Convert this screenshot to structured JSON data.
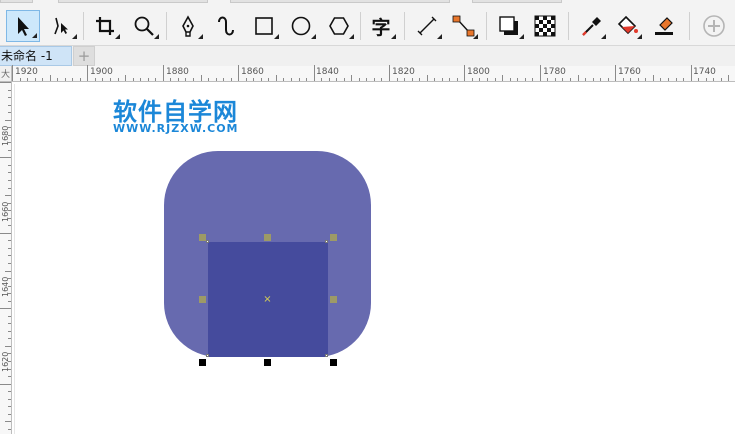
{
  "toolbar": {
    "tools": [
      {
        "name": "pick-tool",
        "icon": "arrow-pointer-icon",
        "active": true
      },
      {
        "name": "shape-tool",
        "icon": "node-edit-icon"
      },
      {
        "name": "crop-tool",
        "icon": "crop-icon"
      },
      {
        "name": "zoom-tool",
        "icon": "magnifier-icon"
      },
      {
        "name": "freehand-tool",
        "icon": "pen-nib-icon"
      },
      {
        "name": "artistic-media-tool",
        "icon": "curve-icon"
      },
      {
        "name": "rectangle-tool",
        "icon": "rectangle-icon"
      },
      {
        "name": "ellipse-tool",
        "icon": "ellipse-icon"
      },
      {
        "name": "polygon-tool",
        "icon": "hexagon-icon"
      },
      {
        "name": "text-tool",
        "icon": "text-char-icon",
        "glyph": "字"
      },
      {
        "name": "dimension-tool",
        "icon": "diagonal-line-icon"
      },
      {
        "name": "connector-tool",
        "icon": "connector-icon"
      },
      {
        "name": "drop-shadow-tool",
        "icon": "drop-shadow-icon"
      },
      {
        "name": "transparency-tool",
        "icon": "checkerboard-icon"
      },
      {
        "name": "eyedropper-tool",
        "icon": "eyedropper-icon"
      },
      {
        "name": "interactive-fill-tool",
        "icon": "fill-bucket-icon"
      },
      {
        "name": "smart-fill-tool",
        "icon": "eraser-fill-icon"
      },
      {
        "name": "add-tool",
        "icon": "plus-circle-icon"
      }
    ]
  },
  "tabs": {
    "document_label": "未命名 -1",
    "add_label": "+"
  },
  "ruler_h": {
    "labels": [
      "1920",
      "1900",
      "1880",
      "1860",
      "1840",
      "1820",
      "1800",
      "1780",
      "1760",
      "1740"
    ],
    "corner_glyph": "大"
  },
  "ruler_v": {
    "labels": [
      "1680",
      "1660",
      "1640",
      "1620"
    ]
  },
  "watermark": {
    "title": "软件自学网",
    "url": "WWW.RJZXW.COM"
  },
  "colors": {
    "rounded_fill": "#676aaf",
    "square_fill": "#454b9d",
    "watermark": "#1b87d8",
    "handle": "#9d9a66"
  }
}
